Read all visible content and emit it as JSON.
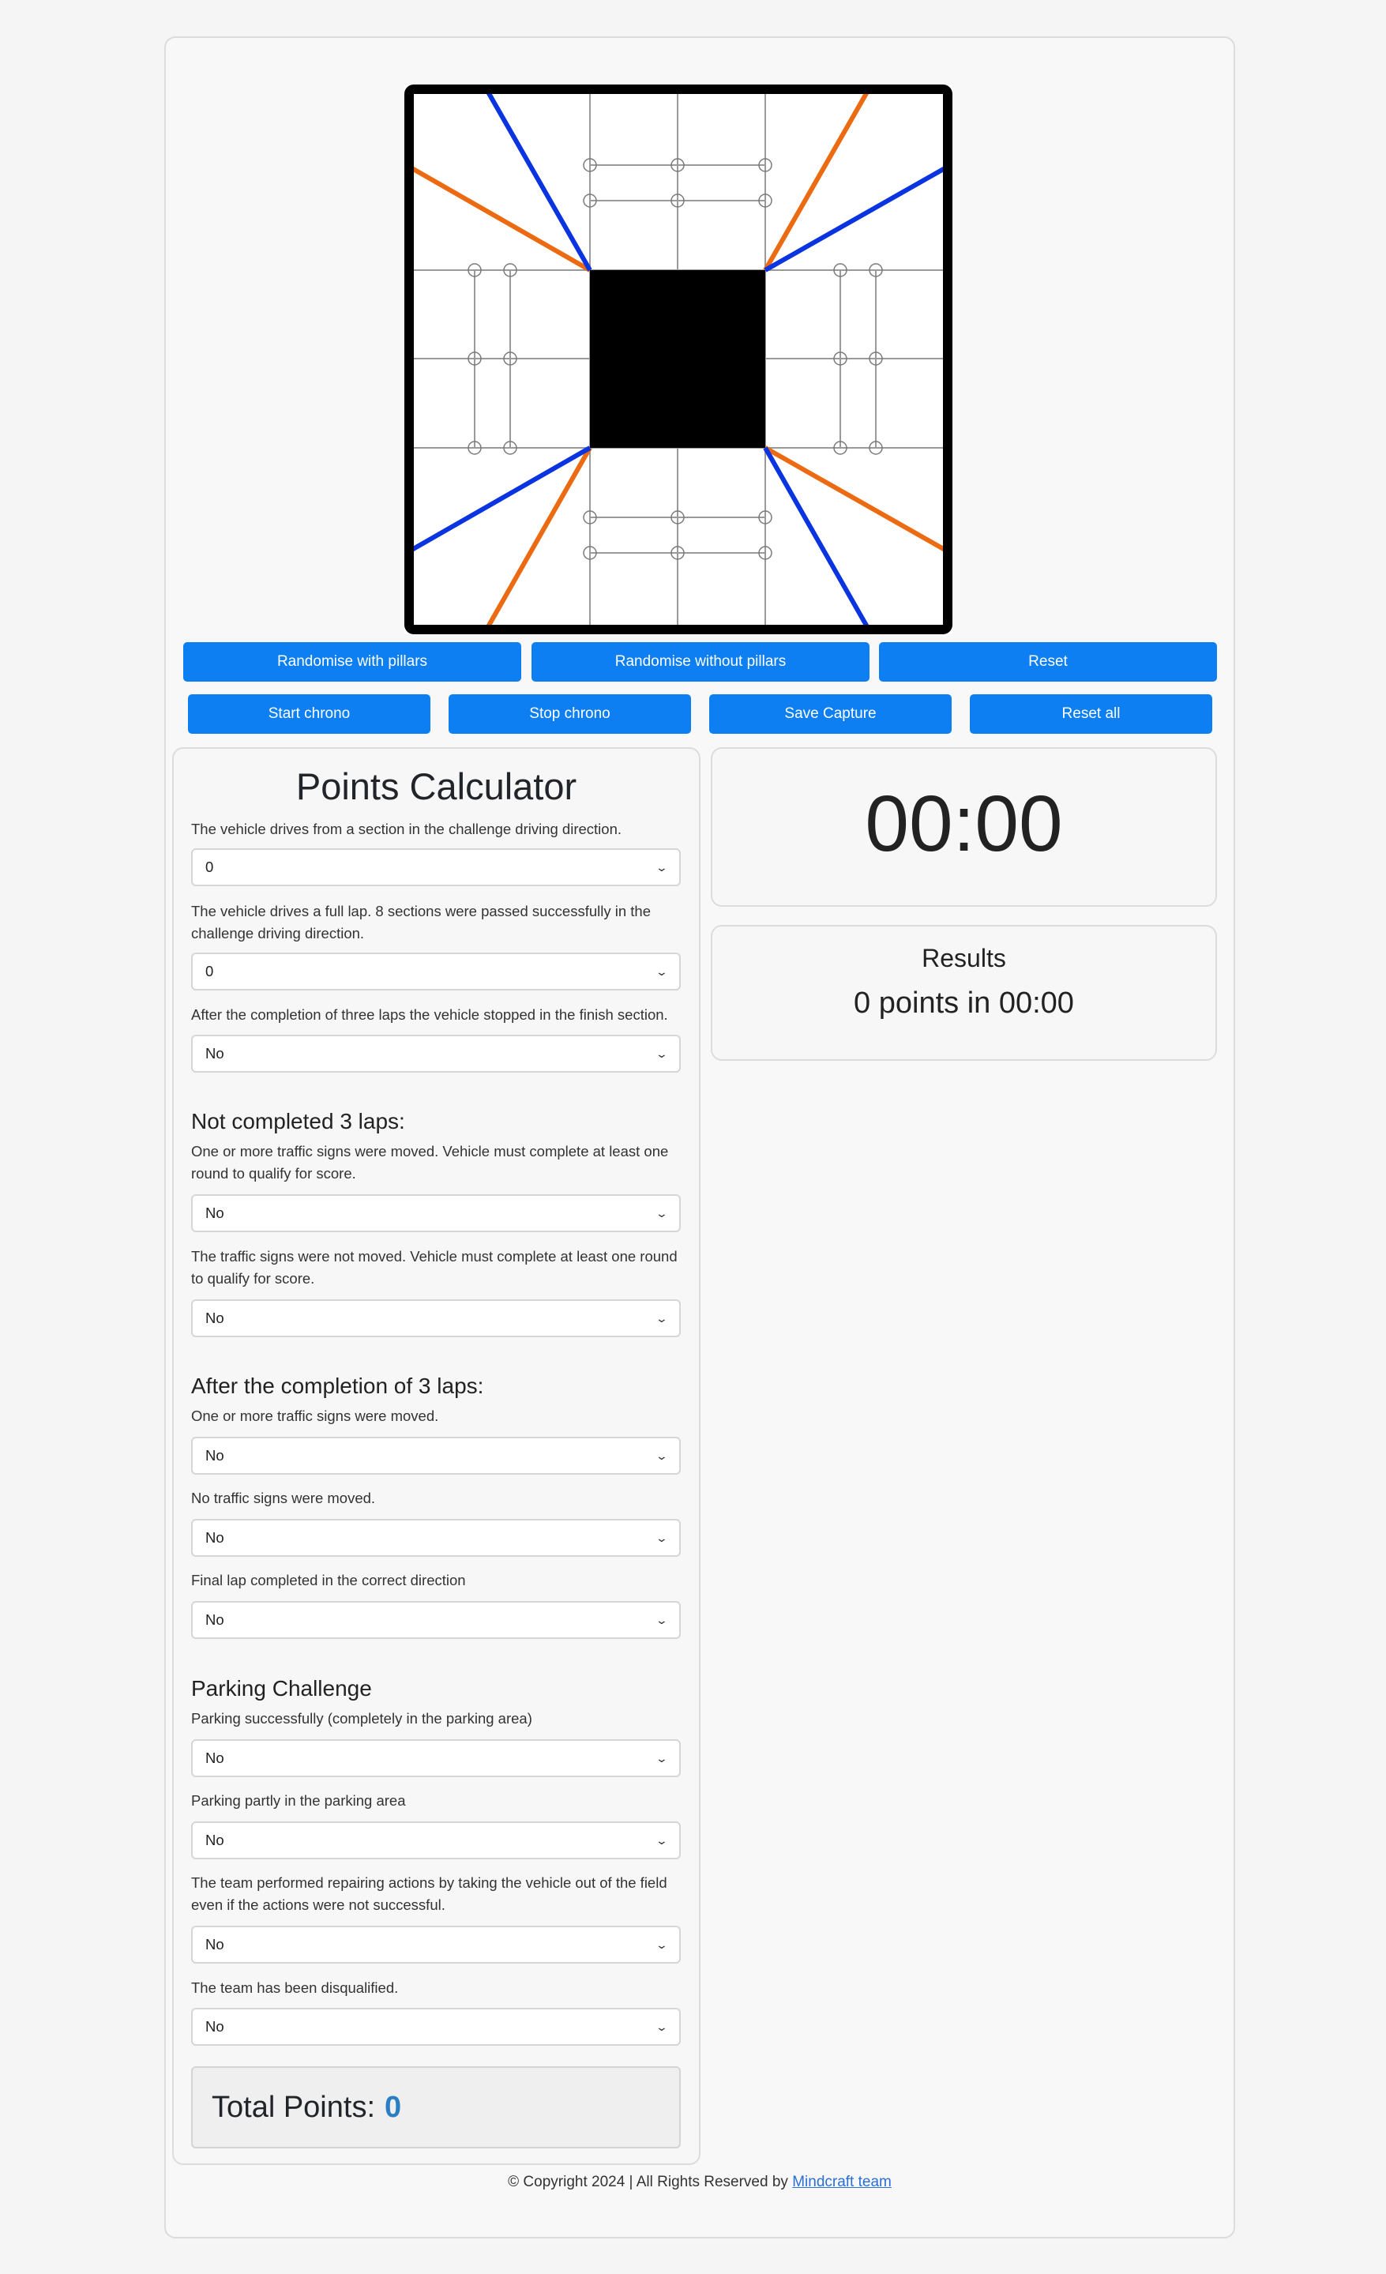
{
  "buttons": {
    "row1": [
      "Randomise with pillars",
      "Randomise without pillars",
      "Reset"
    ],
    "row2": [
      "Start chrono",
      "Stop chrono",
      "Save Capture",
      "Reset all"
    ]
  },
  "calculator": {
    "title": "Points Calculator",
    "q1": {
      "label": "The vehicle drives from a section in the challenge driving direction.",
      "value": "0"
    },
    "q2": {
      "label": "The vehicle drives a full lap. 8 sections were passed successfully in the challenge driving direction.",
      "value": "0"
    },
    "q3": {
      "label": "After the completion of three laps the vehicle stopped in the finish section.",
      "value": "No"
    },
    "section_not_completed": "Not completed 3 laps:",
    "q4": {
      "label": "One or more traffic signs were moved. Vehicle must complete at least one round to qualify for score.",
      "value": "No"
    },
    "q5": {
      "label": "The traffic signs were not moved. Vehicle must complete at least one round to qualify for score.",
      "value": "No"
    },
    "section_after": "After the completion of 3 laps:",
    "q6": {
      "label": "One or more traffic signs were moved.",
      "value": "No"
    },
    "q7": {
      "label": "No traffic signs were moved.",
      "value": "No"
    },
    "q8": {
      "label": "Final lap completed in the correct direction",
      "value": "No"
    },
    "section_parking": "Parking Challenge",
    "q9": {
      "label": "Parking successfully (completely in the parking area)",
      "value": "No"
    },
    "q10": {
      "label": "Parking partly in the parking area",
      "value": "No"
    },
    "q11": {
      "label": "The team performed repairing actions by taking the vehicle out of the field even if the actions were not successful.",
      "value": "No"
    },
    "q12": {
      "label": "The team has been disqualified.",
      "value": "No"
    },
    "total_label": "Total Points:",
    "total_value": "0"
  },
  "chrono": {
    "time": "00:00"
  },
  "results": {
    "title": "Results",
    "summary": "0 points in 00:00"
  },
  "footer": {
    "text": "© Copyright 2024 | All Rights Reserved by",
    "link": "Mindcraft team"
  },
  "colors": {
    "accent": "#0d7ff2",
    "orange_line": "#ec6a12",
    "blue_line": "#0a34e0",
    "total_value": "#2a7ec3"
  },
  "icons": {
    "select": "chevron-down-icon"
  }
}
